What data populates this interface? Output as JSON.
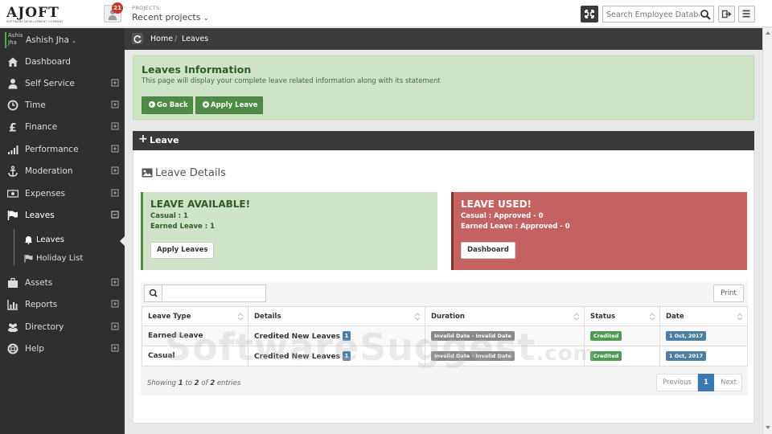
{
  "brand": {
    "logo_text": "AJOFT",
    "logo_tagline": "SOFTWARE DEVELOPMENT COMPANY"
  },
  "topbar": {
    "projects_label": "PROJECTS:",
    "projects_value": "Recent projects",
    "projects_badge": "21",
    "search_placeholder": "Search Employee Database"
  },
  "user": {
    "thumb_text": "Ashish Jha",
    "name": "Ashish Jha"
  },
  "sidebar": {
    "items": [
      {
        "label": "Dashboard",
        "icon": "home-icon"
      },
      {
        "label": "Self Service",
        "icon": "user-tie-icon"
      },
      {
        "label": "Time",
        "icon": "clock-icon"
      },
      {
        "label": "Finance",
        "icon": "pound-icon"
      },
      {
        "label": "Performance",
        "icon": "signal-icon"
      },
      {
        "label": "Moderation",
        "icon": "anchor-icon"
      },
      {
        "label": "Expenses",
        "icon": "money-icon"
      },
      {
        "label": "Leaves",
        "icon": "flag-icon",
        "expanded": true
      },
      {
        "label": "Assets",
        "icon": "briefcase-icon"
      },
      {
        "label": "Reports",
        "icon": "bar-chart-icon"
      },
      {
        "label": "Directory",
        "icon": "users-icon"
      },
      {
        "label": "Help",
        "icon": "lifebuoy-icon"
      }
    ],
    "subitems": [
      {
        "label": "Leaves",
        "icon": "bell-icon",
        "active": true
      },
      {
        "label": "Holiday List",
        "icon": "flag-icon"
      }
    ]
  },
  "breadcrumb": {
    "home": "Home",
    "separator": "/",
    "current": "Leaves"
  },
  "info": {
    "title": "Leaves Information",
    "description": "This page will display your complete leave related information along with its statement",
    "go_back": "Go Back",
    "apply_leave": "Apply Leave"
  },
  "leave_panel": {
    "plus": "+",
    "title": "Leave",
    "details_title": "Leave Details"
  },
  "available": {
    "title": "LEAVE AVAILABLE!",
    "line1": "Casual : 1",
    "line2": "Earned Leave : 1",
    "button": "Apply Leaves"
  },
  "used": {
    "title": "LEAVE USED!",
    "line1": "Casual : Approved - 0",
    "line2": "Earned Leave : Approved - 0",
    "button": "Dashboard"
  },
  "table": {
    "print": "Print",
    "columns": [
      "Leave Type",
      "Details",
      "Duration",
      "Status",
      "Date"
    ],
    "rows": [
      {
        "type": "Earned Leave",
        "details": "Credited New Leaves",
        "count": "1",
        "duration": "Invalid Date - Invalid Date",
        "status": "Credited",
        "date": "1 Oct, 2017"
      },
      {
        "type": "Casual",
        "details": "Credited New Leaves",
        "count": "1",
        "duration": "Invalid Date - Invalid Date",
        "status": "Credited",
        "date": "1 Oct, 2017"
      }
    ],
    "showing_prefix": "Showing",
    "showing_from": "1",
    "showing_to_word": "to",
    "showing_to": "2",
    "showing_of_word": "of",
    "showing_total": "2",
    "showing_suffix": "entries",
    "pager": {
      "prev": "Previous",
      "page": "1",
      "next": "Next"
    }
  },
  "watermark": {
    "text": "SoftwareSuggest",
    "domain": ".com"
  },
  "colors": {
    "sidebar": "#2f2f2f",
    "success_bg": "#cfe3c7",
    "success_btn": "#4f8a47",
    "danger_bg": "#c46161",
    "primary": "#3a78b0"
  }
}
